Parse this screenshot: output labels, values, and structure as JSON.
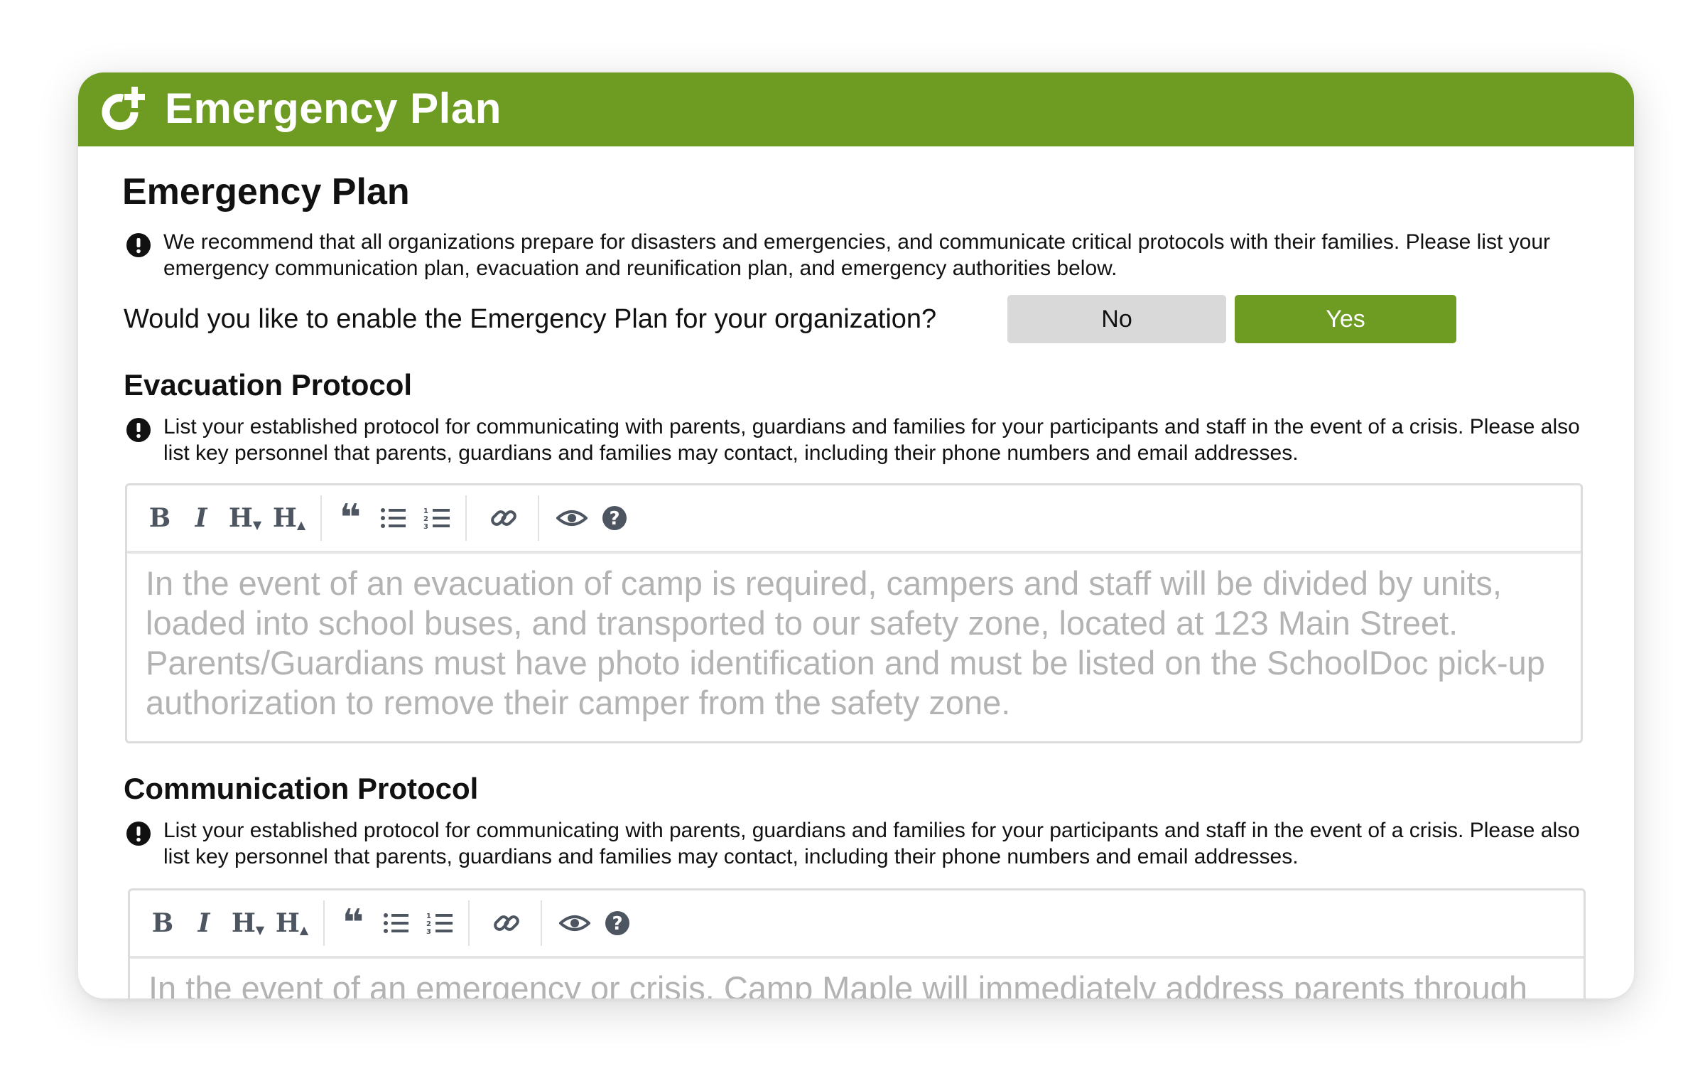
{
  "header": {
    "title": "Emergency Plan",
    "logo_icon": "refresh-plus-icon",
    "color": "#6e9b22"
  },
  "main": {
    "heading": "Emergency Plan",
    "intro_notice": "We recommend that all organizations prepare for disasters and emergencies, and communicate critical protocols with their families. Please list your emergency communication plan, evacuation and reunification plan, and emergency authorities below.",
    "enable_question": "Would you like to enable the Emergency Plan for your organization?",
    "toggle": {
      "no_label": "No",
      "yes_label": "Yes",
      "selected": "Yes"
    }
  },
  "sections": [
    {
      "title": "Evacuation Protocol",
      "notice": "List your established protocol for communicating with parents, guardians and families for your participants and staff in the event of a crisis. Please also list key personnel that parents, guardians and families may contact, including their phone numbers and email addresses.",
      "content": "In the event of an evacuation of camp is required, campers and staff will be divided by units, loaded into school buses, and transported to our safety zone, located at 123 Main Street. Parents/Guardians must have photo identification and must be listed on the SchoolDoc pick-up authorization to remove their camper from the safety zone."
    },
    {
      "title": "Communication Protocol",
      "notice": "List your established protocol for communicating with parents, guardians and families for your participants and staff in the event of a crisis. Please also list key personnel that parents, guardians and families may contact, including their phone numbers and email addresses.",
      "content": "In the event of an emergency or crisis, Camp Maple will immediately address parents through"
    }
  ],
  "toolbar": {
    "bold": "B",
    "italic": "I",
    "heading_smaller": "H",
    "heading_bigger": "H",
    "icons": [
      "bold-icon",
      "italic-icon",
      "heading-smaller-icon",
      "heading-bigger-icon",
      "quote-icon",
      "unordered-list-icon",
      "ordered-list-icon",
      "link-icon",
      "preview-icon",
      "help-icon"
    ]
  },
  "colors": {
    "accent": "#6e9b22",
    "toggle_off": "#d9d9d9",
    "placeholder_text": "#b3b3b3",
    "toolbar_icon": "#4d5560"
  }
}
